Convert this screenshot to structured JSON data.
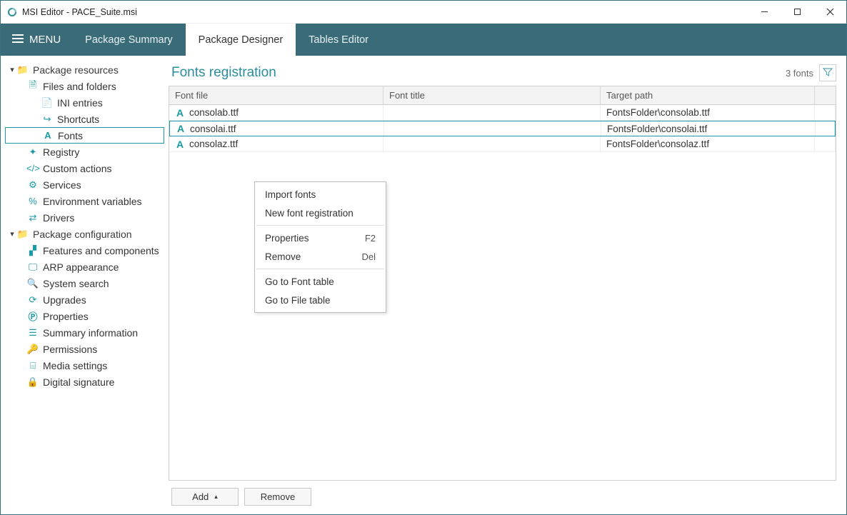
{
  "titlebar": {
    "title": "MSI Editor - PACE_Suite.msi"
  },
  "menubar": {
    "menu_label": "MENU",
    "tabs": [
      {
        "label": "Package Summary"
      },
      {
        "label": "Package Designer"
      },
      {
        "label": "Tables Editor"
      }
    ],
    "active_tab_index": 1
  },
  "sidebar": {
    "groups": [
      {
        "label": "Package resources",
        "children": [
          {
            "label": "Files and folders",
            "icon": "file-icon",
            "children": [
              {
                "label": "INI entries",
                "icon": "ini-icon"
              },
              {
                "label": "Shortcuts",
                "icon": "shortcut-icon"
              },
              {
                "label": "Fonts",
                "icon": "font-icon",
                "selected": true
              }
            ]
          },
          {
            "label": "Registry",
            "icon": "registry-icon"
          },
          {
            "label": "Custom actions",
            "icon": "code-icon"
          },
          {
            "label": "Services",
            "icon": "gear-icon"
          },
          {
            "label": "Environment variables",
            "icon": "percent-icon"
          },
          {
            "label": "Drivers",
            "icon": "swap-icon"
          }
        ]
      },
      {
        "label": "Package configuration",
        "children": [
          {
            "label": "Features and components",
            "icon": "puzzle-icon"
          },
          {
            "label": "ARP appearance",
            "icon": "monitor-icon"
          },
          {
            "label": "System search",
            "icon": "search-icon"
          },
          {
            "label": "Upgrades",
            "icon": "refresh-icon"
          },
          {
            "label": "Properties",
            "icon": "p-icon"
          },
          {
            "label": "Summary information",
            "icon": "lines-icon"
          },
          {
            "label": "Permissions",
            "icon": "key-icon"
          },
          {
            "label": "Media settings",
            "icon": "drive-icon"
          },
          {
            "label": "Digital signature",
            "icon": "lock-icon"
          }
        ]
      }
    ]
  },
  "main": {
    "title": "Fonts registration",
    "count_text": "3 fonts",
    "columns": [
      "Font file",
      "Font title",
      "Target path"
    ],
    "rows": [
      {
        "file": "consolab.ttf",
        "title": "",
        "path": "FontsFolder\\consolab.ttf"
      },
      {
        "file": "consolai.ttf",
        "title": "",
        "path": "FontsFolder\\consolai.ttf",
        "selected": true
      },
      {
        "file": "consolaz.ttf",
        "title": "",
        "path": "FontsFolder\\consolaz.ttf"
      }
    ]
  },
  "context_menu": {
    "items": [
      {
        "label": "Import fonts"
      },
      {
        "label": "New font registration"
      },
      {
        "sep": true
      },
      {
        "label": "Properties",
        "shortcut": "F2"
      },
      {
        "label": "Remove",
        "shortcut": "Del"
      },
      {
        "sep": true
      },
      {
        "label": "Go to Font table"
      },
      {
        "label": "Go to File table"
      }
    ]
  },
  "footer": {
    "add_label": "Add",
    "remove_label": "Remove"
  }
}
